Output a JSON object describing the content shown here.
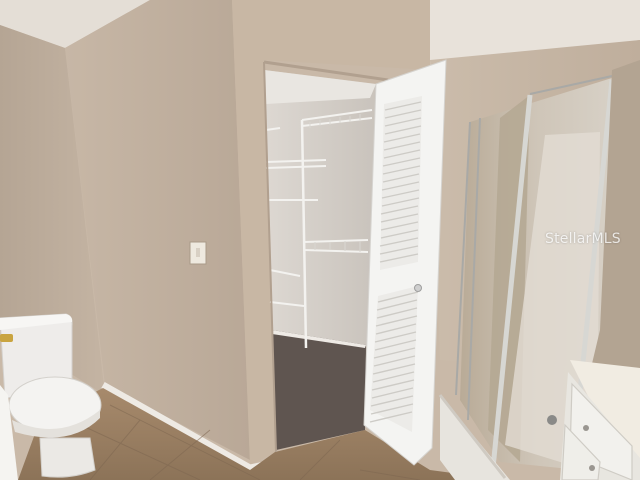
{
  "photo": {
    "watermark": "StellarMLS"
  },
  "colors": {
    "wall": "#b9a99a",
    "wall_light": "#cdbfb0",
    "ceiling": "#e6e1da",
    "door": "#f4f4f2",
    "carpet": "#5e544f",
    "tile": "#9a7f62",
    "chrome": "#c9c9c6"
  }
}
